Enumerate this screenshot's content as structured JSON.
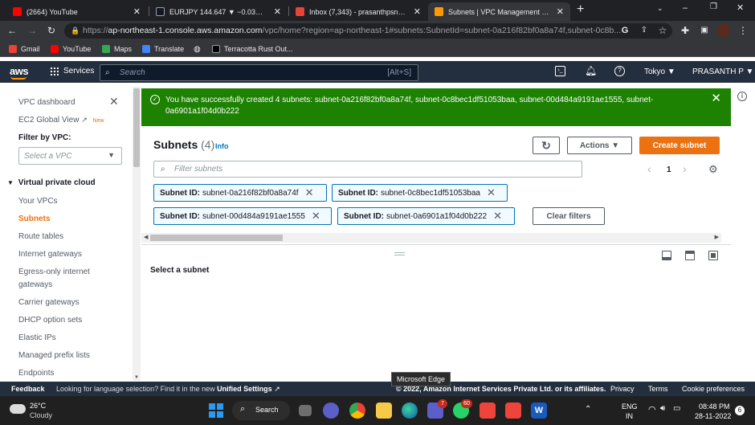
{
  "browser": {
    "tabs": [
      {
        "title": "(2664) YouTube"
      },
      {
        "title": "EURJPY 144.647 ▼ −0.03% Unna"
      },
      {
        "title": "Inbox (7,343) - prasanthpsn007@"
      },
      {
        "title": "Subnets | VPC Management Con"
      }
    ],
    "new_tab": "+",
    "url_host": "ap-northeast-1.console.aws.amazon.com",
    "url_prefix": "https://",
    "url_path": "/vpc/home?region=ap-northeast-1#subnets:SubnetId=subnet-0a216f82bf0a8a74f,subnet-0c8b...",
    "bookmarks": [
      "Gmail",
      "YouTube",
      "Maps",
      "Translate",
      "Terracotta Rust Out..."
    ]
  },
  "aws_nav": {
    "logo": "aws",
    "services": "Services",
    "search_placeholder": "Search",
    "search_hint": "[Alt+S]",
    "region": "Tokyo ▼",
    "user": "PRASANTH P ▼"
  },
  "sidebar": {
    "dashboard": "VPC dashboard",
    "ec2_global_view": "EC2 Global View",
    "new_badge": "New",
    "filter_label": "Filter by VPC:",
    "filter_placeholder": "Select a VPC",
    "section": "Virtual private cloud",
    "items": [
      {
        "label": "Your VPCs"
      },
      {
        "label": "Subnets"
      },
      {
        "label": "Route tables"
      },
      {
        "label": "Internet gateways"
      },
      {
        "label": "Egress-only internet"
      },
      {
        "label": "gateways"
      },
      {
        "label": "Carrier gateways"
      },
      {
        "label": "DHCP option sets"
      },
      {
        "label": "Elastic IPs"
      },
      {
        "label": "Managed prefix lists"
      },
      {
        "label": "Endpoints"
      }
    ]
  },
  "banner": {
    "message": "You have successfully created 4 subnets: subnet-0a216f82bf0a8a74f, subnet-0c8bec1df51053baa, subnet-00d484a9191ae1555, subnet-0a6901a1f04d0b222"
  },
  "main": {
    "title": "Subnets",
    "count": "(4)",
    "info": "Info",
    "actions": "Actions ▼",
    "create": "Create subnet",
    "filter_placeholder": "Filter subnets",
    "page": "1",
    "tokens": [
      {
        "key": "Subnet ID:",
        "value": "subnet-0a216f82bf0a8a74f"
      },
      {
        "key": "Subnet ID:",
        "value": "subnet-0c8bec1df51053baa"
      },
      {
        "key": "Subnet ID:",
        "value": "subnet-00d484a9191ae1555"
      },
      {
        "key": "Subnet ID:",
        "value": "subnet-0a6901a1f04d0b222"
      }
    ],
    "clear_filters": "Clear filters",
    "detail_prompt": "Select a subnet"
  },
  "tooltip": "Microsoft Edge",
  "footer": {
    "feedback": "Feedback",
    "language_prompt": "Looking for language selection? Find it in the new",
    "unified_settings": "Unified Settings",
    "copyright": "© 2022, Amazon Internet Services Private Ltd. or its affiliates.",
    "privacy": "Privacy",
    "terms": "Terms",
    "cookies": "Cookie preferences"
  },
  "taskbar": {
    "temp": "26°C",
    "weather": "Cloudy",
    "search": "Search",
    "lang1": "ENG",
    "lang2": "IN",
    "time": "08:48 PM",
    "date": "28-11-2022",
    "notif": "6",
    "badge_teams": "7",
    "badge_whatsapp": "60"
  },
  "colors": {
    "aws_orange": "#ec7211",
    "success_green": "#1d8102",
    "aws_navy": "#232f3e",
    "link_blue": "#0073bb"
  }
}
